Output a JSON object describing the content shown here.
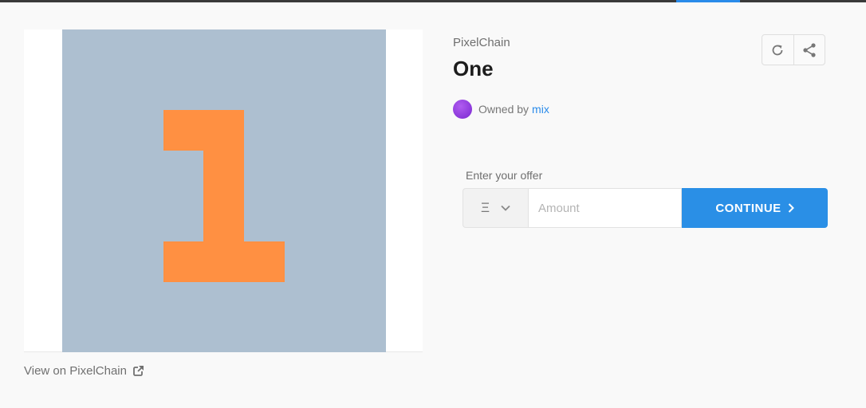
{
  "asset": {
    "collection": "PixelChain",
    "title": "One",
    "art_number_icon": "pixel-digit-one",
    "colors": {
      "background": "#adbfd0",
      "digit": "#ff9042"
    }
  },
  "owner": {
    "prefix": "Owned by",
    "name": "mix"
  },
  "view_link": {
    "label": "View on PixelChain",
    "icon": "external-link-icon"
  },
  "actions": {
    "refresh_icon": "refresh-icon",
    "share_icon": "share-icon"
  },
  "offer": {
    "label": "Enter your offer",
    "currency": "Ξ",
    "amount_value": "",
    "amount_placeholder": "Amount",
    "continue_label": "CONTINUE",
    "accent_color": "#2a8fe6"
  }
}
